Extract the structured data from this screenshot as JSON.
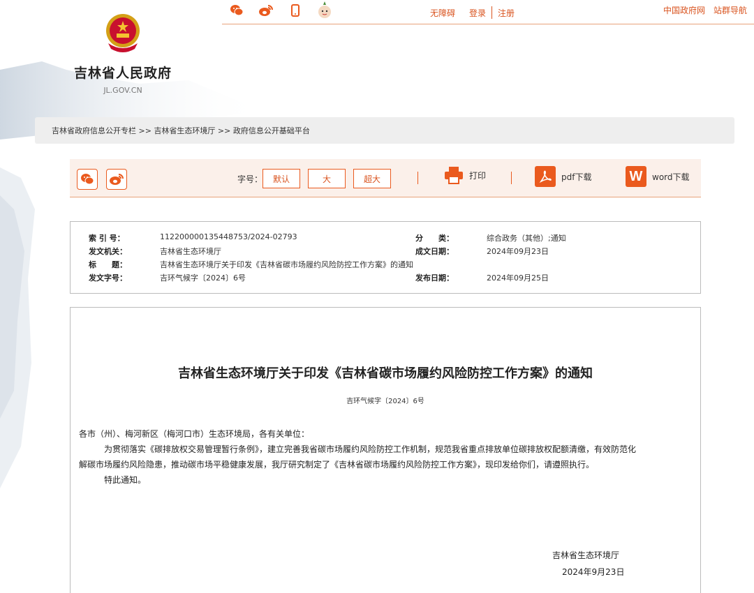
{
  "header": {
    "top_links": {
      "accessibility": "无障碍",
      "login": "登录",
      "register": "注册"
    },
    "top_right": {
      "gov_site": "中国政府网",
      "site_nav": "站群导航"
    },
    "site_name": "吉林省人民政府",
    "site_domain": "JL.GOV.CN",
    "top_icons": [
      "wechat-icon",
      "weibo-icon",
      "mobile-icon",
      "mascot-icon"
    ]
  },
  "breadcrumb": {
    "items": [
      "吉林省政府信息公开专栏",
      "吉林省生态环境厅",
      "政府信息公开基础平台"
    ],
    "separator": " >> "
  },
  "toolbar": {
    "font_label": "字号：",
    "font_default": "默认",
    "font_large": "大",
    "font_xlarge": "超大",
    "print": "打印",
    "pdf": "pdf下载",
    "word": "word下载",
    "word_icon_letter": "W",
    "share_icons": [
      "wechat-icon",
      "weibo-icon"
    ]
  },
  "meta": {
    "index_no_label": "索 引 号：",
    "index_no": "11220000013544875З/2024-02793",
    "category_label": "分　　类：",
    "category": "综合政务（其他）;通知",
    "issuer_label": "发文机关：",
    "issuer": "吉林省生态环境厅",
    "date_written_label": "成文日期：",
    "date_written": "2024年09月23日",
    "title_label": "标　　题：",
    "title": "吉林省生态环境厅关于印发《吉林省碳市场履约风险防控工作方案》的通知",
    "doc_no_label": "发文字号：",
    "doc_no": "吉环气候字〔2024〕6号",
    "publish_date_label": "发布日期：",
    "publish_date": "2024年09月25日"
  },
  "document": {
    "title": "吉林省生态环境厅关于印发《吉林省碳市场履约风险防控工作方案》的通知",
    "doc_no": "吉环气候字〔2024〕6号",
    "addressee": "各市（州）、梅河新区（梅河口市）生态环境局，各有关单位：",
    "body_line1": "为贯彻落实《碳排放权交易管理暂行条例》，建立完善我省碳市场履约风险防控工作机制，规范我省重点排放单位碳排放权配额清缴，有效防范化",
    "body_line2": "解碳市场履约风险隐患，推动碳市场平稳健康发展，我厅研究制定了《吉林省碳市场履约风险防控工作方案》，现印发给你们，请遵照执行。",
    "closing": "特此通知。",
    "signature_org": "吉林省生态环境厅",
    "signature_date": "2024年9月23日"
  },
  "colors": {
    "accent": "#ea5a1e",
    "link": "#d9531e",
    "breadcrumb_bg": "#eeeeee",
    "toolbar_bg": "#fbf0ea"
  }
}
